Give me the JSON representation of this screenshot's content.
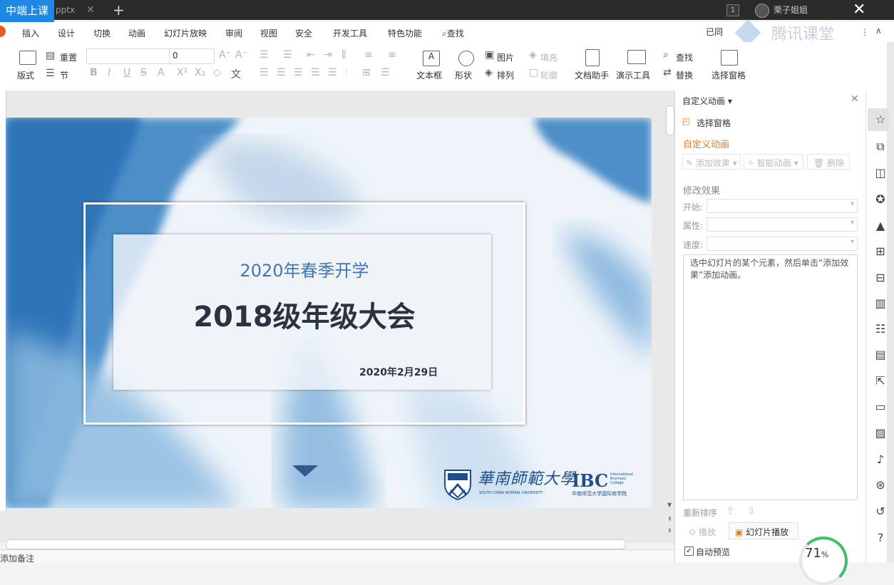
{
  "titlebar": {
    "badge": "中端上课",
    "tab_label": "pptx",
    "tab_close": "✕",
    "new_tab": "+",
    "window_count": "1",
    "username": "栗子姐姐",
    "close": "✕"
  },
  "menu": {
    "items": [
      "插入",
      "设计",
      "切换",
      "动画",
      "幻灯片放映",
      "审阅",
      "视图",
      "安全",
      "开发工具",
      "特色功能"
    ],
    "search": "查找",
    "right_status": "已同",
    "watermark": "腾讯课堂"
  },
  "ribbon": {
    "layout": "版式",
    "reset": "重置",
    "section": "节",
    "font_size": "0",
    "textbox": "文本框",
    "shape": "形状",
    "picture": "图片",
    "fill": "填充",
    "arrange": "排列",
    "outline": "轮廓",
    "doc_helper": "文档助手",
    "present_tools": "演示工具",
    "find": "查找",
    "replace": "替换",
    "select_pane": "选择窗格"
  },
  "slide": {
    "subtitle": "2020年春季开学",
    "title": "2018级年级大会",
    "date": "2020年2月29日",
    "univ_cn": "華南師範大學",
    "univ_en": "SOUTH CHINA NORMAL UNIVERSITY",
    "ibc": "IBC",
    "ibc_sub": "International Business College",
    "ibc_cn": "华南师范大学国际商学院"
  },
  "notes": {
    "placeholder": "单击此处添加备注"
  },
  "panel": {
    "header": "自定义动画",
    "select_pane": "选择窗格",
    "section_title": "自定义动画",
    "add_effect": "添加效果",
    "smart_anim": "智能动画",
    "delete": "删除",
    "modify_title": "修改效果",
    "start": "开始:",
    "property": "属性:",
    "speed": "速度:",
    "hint": "选中幻灯片的某个元素，然后单击“添加效果”添加动画。",
    "reorder": "重新排序",
    "play": "播放",
    "slideshow": "幻灯片播放",
    "auto_preview": "自动预览",
    "progress": "71",
    "progress_unit": "%"
  },
  "colors": {
    "accent": "#1e88e5",
    "title_text": "#2b3240",
    "subtitle_text": "#3f77b6",
    "panel_title": "#e07c2e"
  }
}
